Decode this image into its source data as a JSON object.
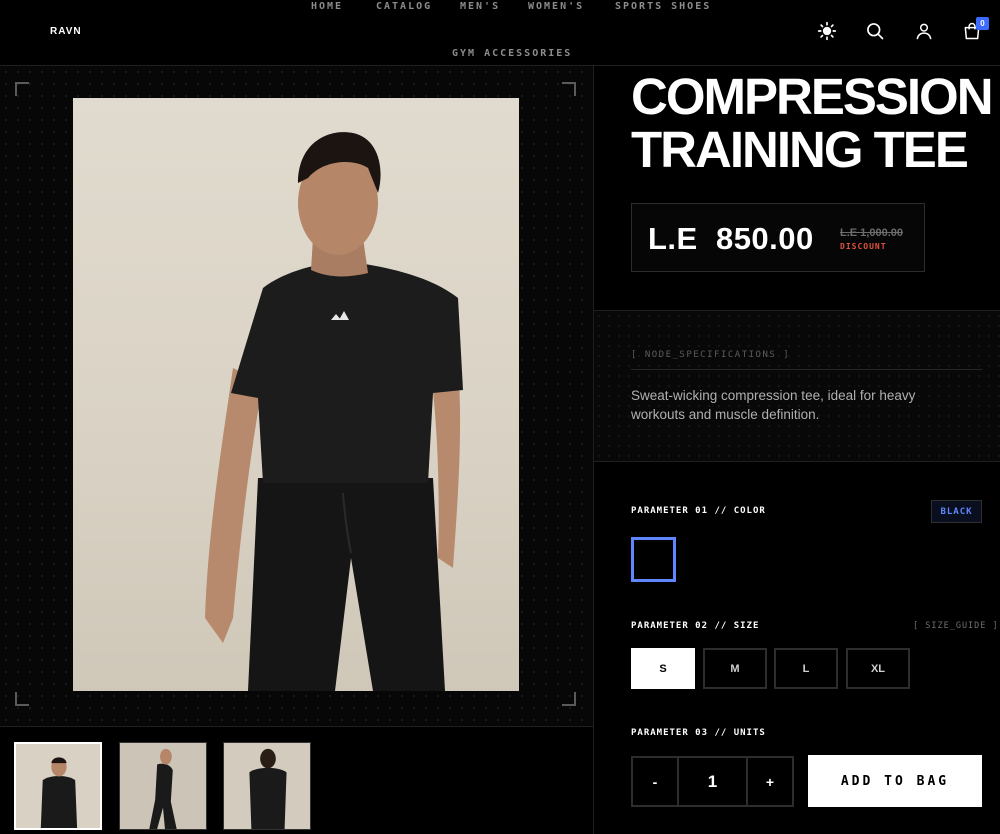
{
  "brand": "RAVN",
  "nav": [
    "HOME",
    "CATALOG",
    "MEN'S",
    "WOMEN'S",
    "SPORTS SHOES",
    "GYM ACCESSORIES"
  ],
  "header_icons": [
    "sun-icon",
    "search-icon",
    "user-icon",
    "shopping-bag-icon"
  ],
  "cart_count": "0",
  "product": {
    "title_line1": "COMPRESSION",
    "title_line2": "TRAINING TEE",
    "price": "L.E  850.00",
    "old_price": "L.E 1,000.00",
    "discount_label": "DISCOUNT",
    "spec_label": "[ NODE_SPECIFICATIONS ]",
    "description": "Sweat-wicking compression tee, ideal for heavy workouts and muscle definition."
  },
  "params": {
    "color_label": "PARAMETER 01 // COLOR",
    "color_value": "BLACK",
    "size_label": "PARAMETER 02 // SIZE",
    "size_guide": "[ SIZE_GUIDE ]",
    "sizes": [
      "S",
      "M",
      "L",
      "XL"
    ],
    "selected_size": "S",
    "units_label": "PARAMETER 03 // UNITS",
    "qty_minus": "-",
    "qty_value": "1",
    "qty_plus": "+",
    "add_to_bag": "ADD TO BAG"
  },
  "colors": {
    "accent": "#5f85ff",
    "discount": "#e0533f",
    "background": "#000000"
  }
}
